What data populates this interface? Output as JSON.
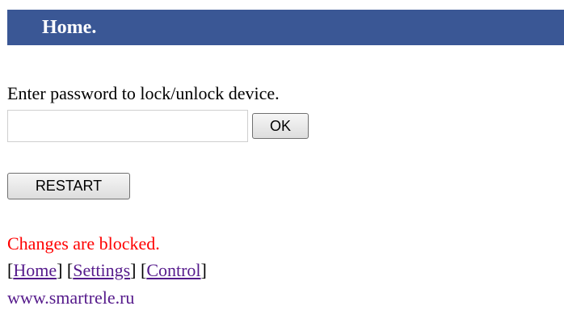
{
  "header": {
    "title": "Home."
  },
  "lock_form": {
    "prompt": "Enter password to lock/unlock device.",
    "password_value": "",
    "ok_label": "OK"
  },
  "restart_label": "RESTART",
  "status_text": "Changes are blocked.",
  "nav": {
    "home": "Home",
    "settings": "Settings",
    "control": "Control"
  },
  "site_text": "www.smartrele.ru",
  "colors": {
    "header_bg": "#3a5795",
    "status": "#ff0000",
    "link": "#551a8b"
  }
}
